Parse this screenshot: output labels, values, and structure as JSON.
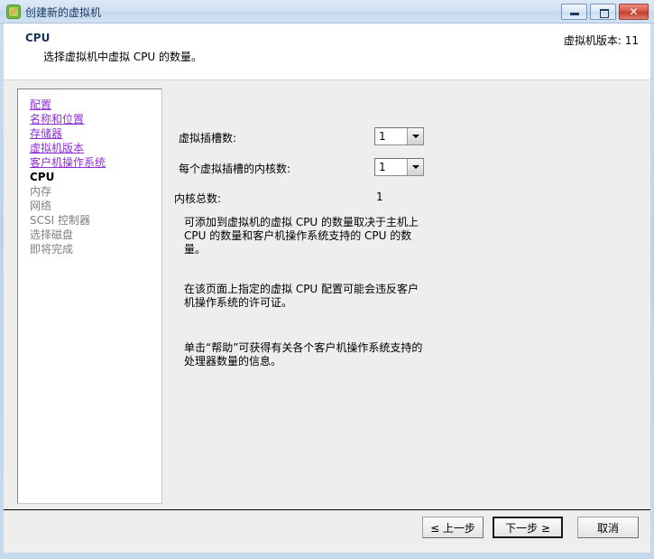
{
  "window": {
    "title": "创建新的虚拟机",
    "icon": "vm-link-icon",
    "buttons": {
      "minimize": "最小化",
      "maximize": "最大化",
      "close": "✕"
    }
  },
  "header": {
    "title": "CPU",
    "subtitle": "选择虚拟机中虚拟 CPU 的数量。",
    "version_label": "虚拟机版本: 11"
  },
  "sidebar": {
    "items": [
      {
        "label": "配置",
        "state": "link"
      },
      {
        "label": "名称和位置",
        "state": "link"
      },
      {
        "label": "存储器",
        "state": "link"
      },
      {
        "label": "虚拟机版本",
        "state": "link"
      },
      {
        "label": "客户机操作系统",
        "state": "link"
      },
      {
        "label": "CPU",
        "state": "current"
      },
      {
        "label": "内存",
        "state": "future"
      },
      {
        "label": "网络",
        "state": "future"
      },
      {
        "label": "SCSI 控制器",
        "state": "future"
      },
      {
        "label": "选择磁盘",
        "state": "future"
      },
      {
        "label": "即将完成",
        "state": "future"
      }
    ]
  },
  "form": {
    "sockets_label": "虚拟插槽数:",
    "sockets_value": "1",
    "cores_label": "每个虚拟插槽的内核数:",
    "cores_value": "1",
    "total_label": "内核总数:",
    "total_value": "1",
    "paragraph1": "可添加到虚拟机的虚拟 CPU 的数量取决于主机上 CPU 的数量和客户机操作系统支持的 CPU 的数量。",
    "paragraph2": "在该页面上指定的虚拟 CPU 配置可能会违反客户机操作系统的许可证。",
    "paragraph3": "单击“帮助”可获得有关各个客户机操作系统支持的处理器数量的信息。"
  },
  "footer": {
    "back_label": "≤ 上一步",
    "next_label": "下一步 ≥",
    "cancel_label": "取消"
  },
  "colors": {
    "link": "#8d2fd6",
    "title": "#16335c",
    "disabled": "#808080",
    "close_button": "#bf3e2e",
    "window_frame": "#c5daed"
  }
}
